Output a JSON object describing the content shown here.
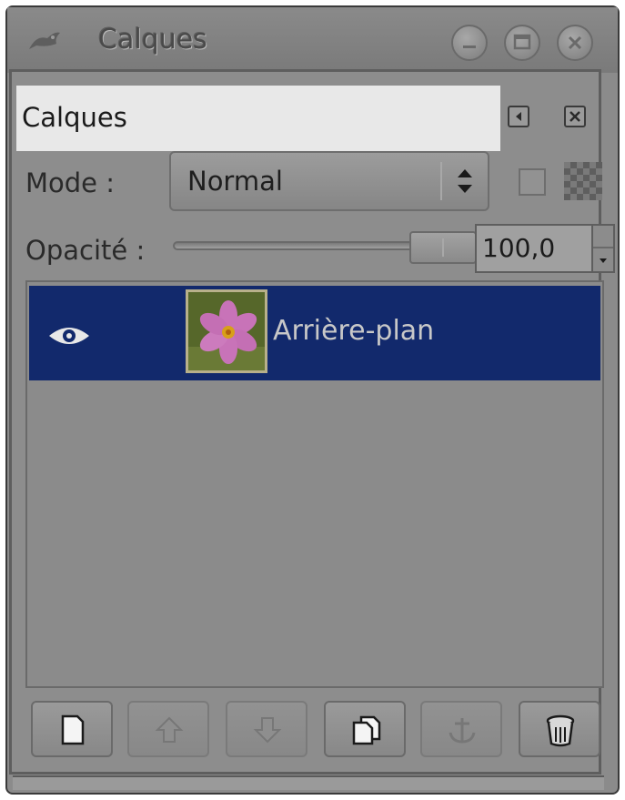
{
  "window": {
    "title": "Calques",
    "icon": "gimp-wilber-icon",
    "controls": [
      "minimize-icon",
      "maximize-icon",
      "close-icon"
    ]
  },
  "dock": {
    "tab_label": "Calques",
    "menu_icon": "tab-menu-icon",
    "close_icon": "close-icon"
  },
  "mode": {
    "label": "Mode :",
    "value": "Normal"
  },
  "opacity": {
    "label": "Opacité :",
    "value": "100,0",
    "fraction": 1.0
  },
  "layers": [
    {
      "name": "Arrière-plan",
      "visible": true,
      "selected": true,
      "thumbnail": "pink-cosmos-flower"
    }
  ],
  "toolbar": [
    {
      "icon": "new-layer-icon",
      "enabled": true
    },
    {
      "icon": "raise-layer-icon",
      "enabled": false
    },
    {
      "icon": "lower-layer-icon",
      "enabled": false
    },
    {
      "icon": "duplicate-layer-icon",
      "enabled": true
    },
    {
      "icon": "anchor-layer-icon",
      "enabled": false
    },
    {
      "icon": "delete-layer-icon",
      "enabled": true
    }
  ],
  "colors": {
    "panel": "#8b8b8b",
    "selection": "#12296c",
    "tab_background": "#e8e8e8"
  }
}
